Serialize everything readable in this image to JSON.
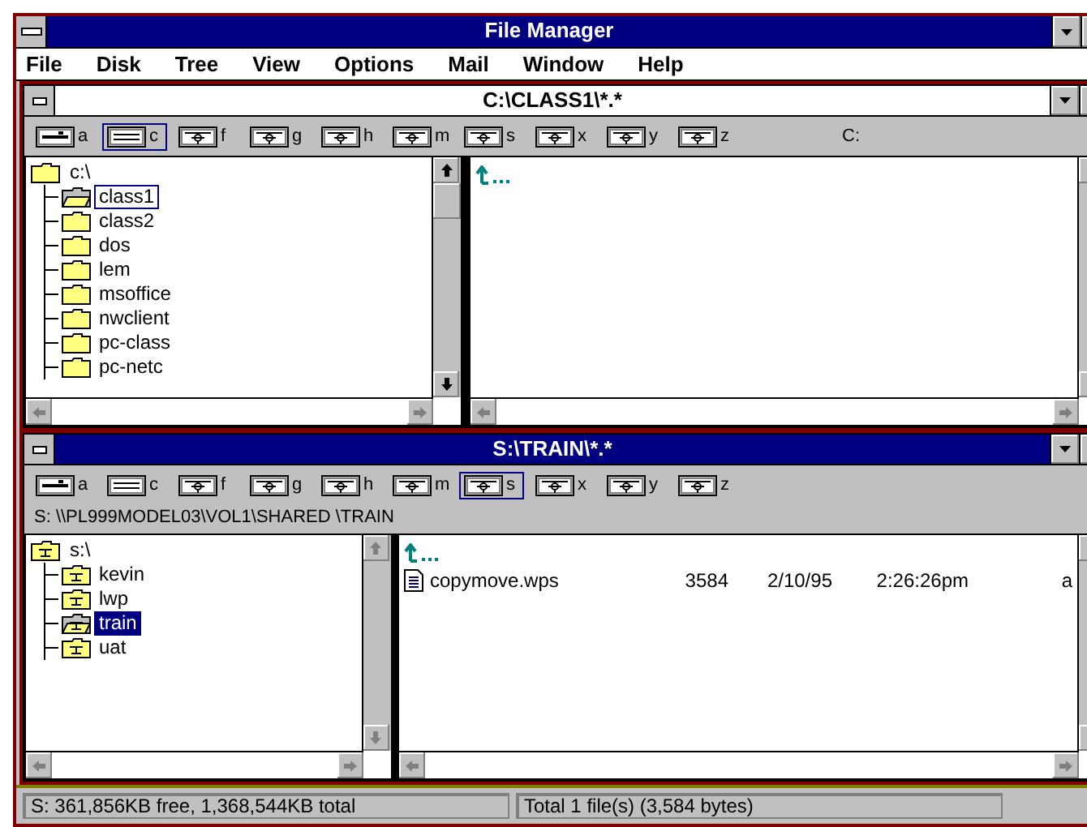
{
  "window": {
    "title": "File Manager"
  },
  "menu": [
    "File",
    "Disk",
    "Tree",
    "View",
    "Options",
    "Mail",
    "Window",
    "Help"
  ],
  "child_windows": [
    {
      "title": "C:\\CLASS1\\*.*",
      "active": false,
      "drive_label": "C:",
      "drives": [
        {
          "letter": "a",
          "kind": "floppy",
          "selected": false
        },
        {
          "letter": "c",
          "kind": "hard",
          "selected": true
        },
        {
          "letter": "f",
          "kind": "network",
          "selected": false
        },
        {
          "letter": "g",
          "kind": "network",
          "selected": false
        },
        {
          "letter": "h",
          "kind": "network",
          "selected": false
        },
        {
          "letter": "m",
          "kind": "network",
          "selected": false
        },
        {
          "letter": "s",
          "kind": "network",
          "selected": false
        },
        {
          "letter": "x",
          "kind": "network",
          "selected": false
        },
        {
          "letter": "y",
          "kind": "network",
          "selected": false
        },
        {
          "letter": "z",
          "kind": "network",
          "selected": false
        }
      ],
      "tree": {
        "label": "c:\\",
        "kind": "local",
        "scroll_enabled": true,
        "children": [
          {
            "label": "class1",
            "selected": true
          },
          {
            "label": "class2",
            "selected": false
          },
          {
            "label": "dos",
            "selected": false
          },
          {
            "label": "lem",
            "selected": false
          },
          {
            "label": "msoffice",
            "selected": false
          },
          {
            "label": "nwclient",
            "selected": false
          },
          {
            "label": "pc-class",
            "selected": false
          },
          {
            "label": "pc-netc",
            "selected": false
          }
        ]
      },
      "files": [
        {
          "kind": "up"
        }
      ]
    },
    {
      "title": "S:\\TRAIN\\*.*",
      "active": true,
      "network_path": "S: \\\\PL999MODEL03\\VOL1\\SHARED  \\TRAIN",
      "drives": [
        {
          "letter": "a",
          "kind": "floppy",
          "selected": false
        },
        {
          "letter": "c",
          "kind": "hard",
          "selected": false
        },
        {
          "letter": "f",
          "kind": "network",
          "selected": false
        },
        {
          "letter": "g",
          "kind": "network",
          "selected": false
        },
        {
          "letter": "h",
          "kind": "network",
          "selected": false
        },
        {
          "letter": "m",
          "kind": "network",
          "selected": false
        },
        {
          "letter": "s",
          "kind": "network",
          "selected": true
        },
        {
          "letter": "x",
          "kind": "network",
          "selected": false
        },
        {
          "letter": "y",
          "kind": "network",
          "selected": false
        },
        {
          "letter": "z",
          "kind": "network",
          "selected": false
        }
      ],
      "tree": {
        "label": "s:\\",
        "kind": "network",
        "scroll_enabled": false,
        "children": [
          {
            "label": "kevin",
            "selected": false
          },
          {
            "label": "lwp",
            "selected": false
          },
          {
            "label": "train",
            "selected": true
          },
          {
            "label": "uat",
            "selected": false
          }
        ]
      },
      "files": [
        {
          "kind": "up"
        },
        {
          "kind": "document",
          "name": "copymove.wps",
          "size": "3584",
          "date": "2/10/95",
          "time": "2:26:26pm",
          "attributes": "a"
        }
      ]
    }
  ],
  "status_bar": [
    "S: 361,856KB free,  1,368,544KB total",
    "Total 1 file(s) (3,584 bytes)"
  ]
}
